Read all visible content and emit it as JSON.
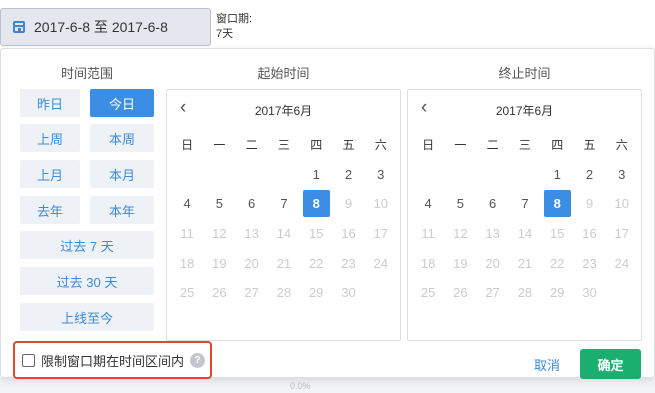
{
  "trigger": {
    "icon": "calendar-icon",
    "value": "2017-6-8 至 2017-6-8"
  },
  "window_info": {
    "label": "窗口期:",
    "value": "7天"
  },
  "popup": {
    "range_title": "时间范围",
    "start_title": "起始时间",
    "end_title": "终止时间",
    "quick_ranges": [
      {
        "label": "昨日",
        "active": false
      },
      {
        "label": "今日",
        "active": true
      },
      {
        "label": "上周",
        "active": false
      },
      {
        "label": "本周",
        "active": false
      },
      {
        "label": "上月",
        "active": false
      },
      {
        "label": "本月",
        "active": false
      },
      {
        "label": "去年",
        "active": false
      },
      {
        "label": "本年",
        "active": false
      },
      {
        "label": "过去 7 天",
        "active": false
      },
      {
        "label": "过去 30 天",
        "active": false
      },
      {
        "label": "上线至今",
        "active": false
      }
    ],
    "start_calendar": {
      "prev": "‹",
      "month": "2017年6月"
    },
    "end_calendar": {
      "prev": "‹",
      "month": "2017年6月"
    },
    "weekdays": [
      "日",
      "一",
      "二",
      "三",
      "四",
      "五",
      "六"
    ],
    "weeks": [
      [
        "",
        "",
        "",
        "",
        "1",
        "2",
        "3"
      ],
      [
        "4",
        "5",
        "6",
        "7",
        "8",
        "9",
        "10"
      ],
      [
        "11",
        "12",
        "13",
        "14",
        "15",
        "16",
        "17"
      ],
      [
        "18",
        "19",
        "20",
        "21",
        "22",
        "23",
        "24"
      ],
      [
        "25",
        "26",
        "27",
        "28",
        "29",
        "30",
        ""
      ]
    ],
    "selected_day": "8",
    "last_enabled_day": 8,
    "limit_checkbox": {
      "label": "限制窗口期在时间区间内",
      "checked": false,
      "help": "?"
    },
    "cancel_label": "取消",
    "confirm_label": "确定"
  },
  "colors": {
    "accent": "#3b8ee3",
    "confirm": "#1aae6f",
    "highlight_border": "#e0472f"
  }
}
